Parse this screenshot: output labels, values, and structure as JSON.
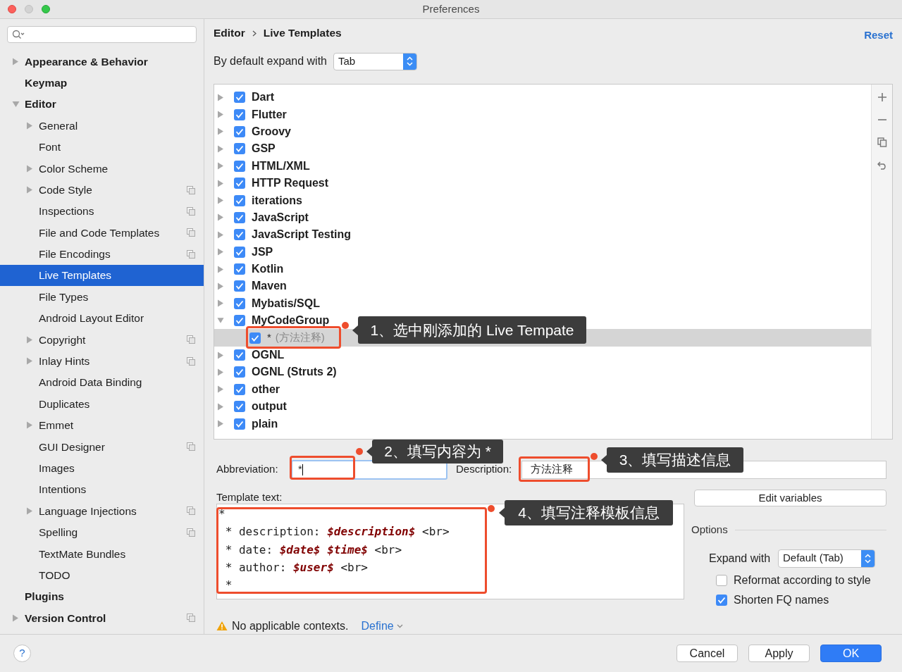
{
  "window": {
    "title": "Preferences"
  },
  "sidebar": {
    "items": [
      {
        "label": "Appearance & Behavior",
        "expanded": false,
        "selected": false,
        "scoped": false
      },
      {
        "label": "Keymap",
        "selected": false,
        "scoped": false
      },
      {
        "label": "Editor",
        "expanded": true,
        "selected": false,
        "scoped": false,
        "children": [
          {
            "label": "General",
            "expanded": false,
            "selected": false,
            "scoped": false
          },
          {
            "label": "Font",
            "selected": false,
            "scoped": false
          },
          {
            "label": "Color Scheme",
            "expanded": false,
            "selected": false,
            "scoped": false
          },
          {
            "label": "Code Style",
            "expanded": false,
            "selected": false,
            "scoped": true
          },
          {
            "label": "Inspections",
            "selected": false,
            "scoped": true
          },
          {
            "label": "File and Code Templates",
            "selected": false,
            "scoped": true
          },
          {
            "label": "File Encodings",
            "selected": false,
            "scoped": true
          },
          {
            "label": "Live Templates",
            "selected": true,
            "scoped": false
          },
          {
            "label": "File Types",
            "selected": false,
            "scoped": false
          },
          {
            "label": "Android Layout Editor",
            "selected": false,
            "scoped": false
          },
          {
            "label": "Copyright",
            "expanded": false,
            "selected": false,
            "scoped": true
          },
          {
            "label": "Inlay Hints",
            "expanded": false,
            "selected": false,
            "scoped": true
          },
          {
            "label": "Android Data Binding",
            "selected": false,
            "scoped": false
          },
          {
            "label": "Duplicates",
            "selected": false,
            "scoped": false
          },
          {
            "label": "Emmet",
            "expanded": false,
            "selected": false,
            "scoped": false
          },
          {
            "label": "GUI Designer",
            "selected": false,
            "scoped": true
          },
          {
            "label": "Images",
            "selected": false,
            "scoped": false
          },
          {
            "label": "Intentions",
            "selected": false,
            "scoped": false
          },
          {
            "label": "Language Injections",
            "expanded": false,
            "selected": false,
            "scoped": true
          },
          {
            "label": "Spelling",
            "selected": false,
            "scoped": true
          },
          {
            "label": "TextMate Bundles",
            "selected": false,
            "scoped": false
          },
          {
            "label": "TODO",
            "selected": false,
            "scoped": false
          }
        ]
      },
      {
        "label": "Plugins",
        "selected": false,
        "scoped": false
      },
      {
        "label": "Version Control",
        "expanded": false,
        "selected": false,
        "scoped": true
      }
    ]
  },
  "breadcrumb": [
    "Editor",
    "Live Templates"
  ],
  "reset_link": "Reset",
  "expand_default": {
    "label": "By default expand with",
    "value": "Tab"
  },
  "template_tree": [
    {
      "label": "Dart",
      "checked": true,
      "expanded": false,
      "selected": false
    },
    {
      "label": "Flutter",
      "checked": true,
      "expanded": false,
      "selected": false
    },
    {
      "label": "Groovy",
      "checked": true,
      "expanded": false,
      "selected": false
    },
    {
      "label": "GSP",
      "checked": true,
      "expanded": false,
      "selected": false
    },
    {
      "label": "HTML/XML",
      "checked": true,
      "expanded": false,
      "selected": false
    },
    {
      "label": "HTTP Request",
      "checked": true,
      "expanded": false,
      "selected": false
    },
    {
      "label": "iterations",
      "checked": true,
      "expanded": false,
      "selected": false
    },
    {
      "label": "JavaScript",
      "checked": true,
      "expanded": false,
      "selected": false
    },
    {
      "label": "JavaScript Testing",
      "checked": true,
      "expanded": false,
      "selected": false
    },
    {
      "label": "JSP",
      "checked": true,
      "expanded": false,
      "selected": false
    },
    {
      "label": "Kotlin",
      "checked": true,
      "expanded": false,
      "selected": false
    },
    {
      "label": "Maven",
      "checked": true,
      "expanded": false,
      "selected": false
    },
    {
      "label": "Mybatis/SQL",
      "checked": true,
      "expanded": false,
      "selected": false
    },
    {
      "label": "MyCodeGroup",
      "checked": true,
      "expanded": true,
      "selected": false,
      "children": [
        {
          "abbreviation": "*",
          "description": "(方法注释)",
          "checked": true,
          "selected": true
        }
      ]
    },
    {
      "label": "OGNL",
      "checked": true,
      "expanded": false,
      "selected": false
    },
    {
      "label": "OGNL (Struts 2)",
      "checked": true,
      "expanded": false,
      "selected": false
    },
    {
      "label": "other",
      "checked": true,
      "expanded": false,
      "selected": false
    },
    {
      "label": "output",
      "checked": true,
      "expanded": false,
      "selected": false
    },
    {
      "label": "plain",
      "checked": true,
      "expanded": false,
      "selected": false
    }
  ],
  "toolbar": [
    {
      "kind": "add"
    },
    {
      "kind": "remove"
    },
    {
      "kind": "copy"
    },
    {
      "kind": "revert"
    }
  ],
  "abbreviation": {
    "label": "Abbreviation:",
    "value": "*"
  },
  "description": {
    "label": "Description:",
    "value": "方法注释"
  },
  "template_text": {
    "label": "Template text:",
    "lines": [
      [
        {
          "text": "*",
          "kind": "plain"
        }
      ],
      [
        {
          "text": " * description: ",
          "kind": "plain"
        },
        {
          "text": "$description$",
          "kind": "variable"
        },
        {
          "text": " <br>",
          "kind": "plain"
        }
      ],
      [
        {
          "text": " * date: ",
          "kind": "plain"
        },
        {
          "text": "$date$ $time$",
          "kind": "variable"
        },
        {
          "text": " <br>",
          "kind": "plain"
        }
      ],
      [
        {
          "text": " * author: ",
          "kind": "plain"
        },
        {
          "text": "$user$",
          "kind": "variable"
        },
        {
          "text": " <br>",
          "kind": "plain"
        }
      ],
      [
        {
          "text": " *",
          "kind": "plain"
        }
      ]
    ]
  },
  "edit_variables_button": "Edit variables",
  "options": {
    "title": "Options",
    "expand_with": {
      "label": "Expand with",
      "value": "Default (Tab)"
    },
    "checkboxes": [
      {
        "label": "Reformat according to style",
        "checked": false
      },
      {
        "label": "Shorten FQ names",
        "checked": true
      }
    ]
  },
  "context_warning": {
    "text": "No applicable contexts.",
    "link": "Define"
  },
  "footer": {
    "help": "?",
    "buttons": [
      {
        "label": "Cancel",
        "kind": "default"
      },
      {
        "label": "Apply",
        "kind": "default"
      },
      {
        "label": "OK",
        "kind": "primary"
      }
    ]
  },
  "annotations": [
    {
      "text": "1、选中刚添加的 Live Tempate"
    },
    {
      "text": "2、填写内容为 *"
    },
    {
      "text": "3、填写描述信息"
    },
    {
      "text": "4、填写注释模板信息"
    }
  ]
}
